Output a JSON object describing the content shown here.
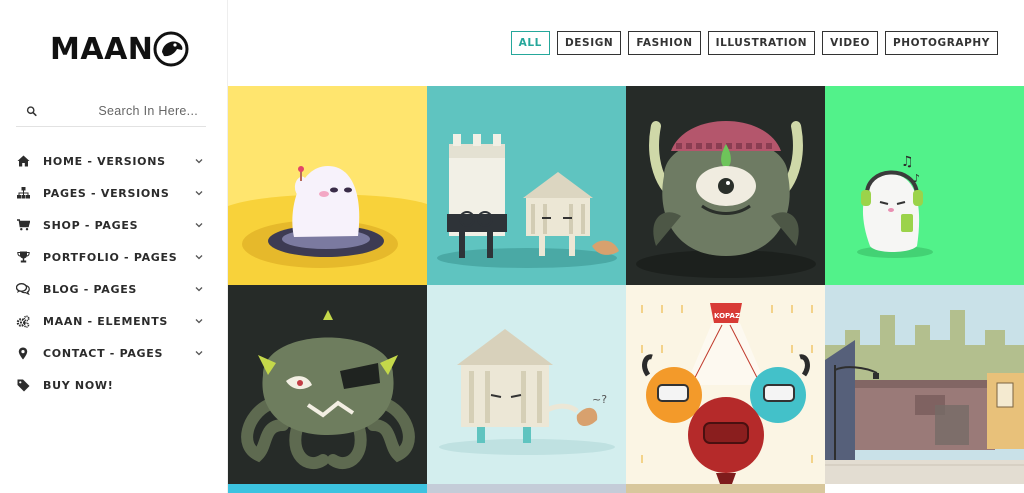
{
  "brand": {
    "logo_text": "MAAN"
  },
  "search": {
    "placeholder": "Search In Here..."
  },
  "menu": [
    {
      "label": "HOME - VERSIONS",
      "icon": "home-icon",
      "has_submenu": true
    },
    {
      "label": "PAGES - VERSIONS",
      "icon": "sitemap-icon",
      "has_submenu": true
    },
    {
      "label": "SHOP - PAGES",
      "icon": "cart-icon",
      "has_submenu": true
    },
    {
      "label": "PORTFOLIO - PAGES",
      "icon": "trophy-icon",
      "has_submenu": true
    },
    {
      "label": "BLOG - PAGES",
      "icon": "comments-icon",
      "has_submenu": true
    },
    {
      "label": "MAAN - ELEMENTS",
      "icon": "cogs-icon",
      "has_submenu": true
    },
    {
      "label": "CONTACT - PAGES",
      "icon": "map-marker-icon",
      "has_submenu": true
    },
    {
      "label": "BUY NOW!",
      "icon": "tag-icon",
      "has_submenu": false
    }
  ],
  "filters": [
    {
      "label": "ALL",
      "active": true
    },
    {
      "label": "DESIGN",
      "active": false
    },
    {
      "label": "FASHION",
      "active": false
    },
    {
      "label": "ILLUSTRATION",
      "active": false
    },
    {
      "label": "VIDEO",
      "active": false
    },
    {
      "label": "PHOTOGRAPHY",
      "active": false
    }
  ],
  "colors": {
    "accent": "#25a79b",
    "tile_yellow": "#ffe56e",
    "tile_teal": "#5fc4c0",
    "tile_dark": "#262b28",
    "tile_green": "#52f28a",
    "tile_pale_blue": "#d3eeee",
    "tile_cream": "#fbf5e4",
    "tile_sky": "#c9e1e8"
  },
  "portfolio": [
    {
      "name": "ghost-float-illustration"
    },
    {
      "name": "buildings-characters-illustration"
    },
    {
      "name": "green-monster-illustration"
    },
    {
      "name": "headphones-ghost-illustration"
    },
    {
      "name": "octopus-pirate-illustration"
    },
    {
      "name": "house-character-illustration"
    },
    {
      "name": "monster-trio-illustration"
    },
    {
      "name": "city-street-illustration"
    }
  ]
}
